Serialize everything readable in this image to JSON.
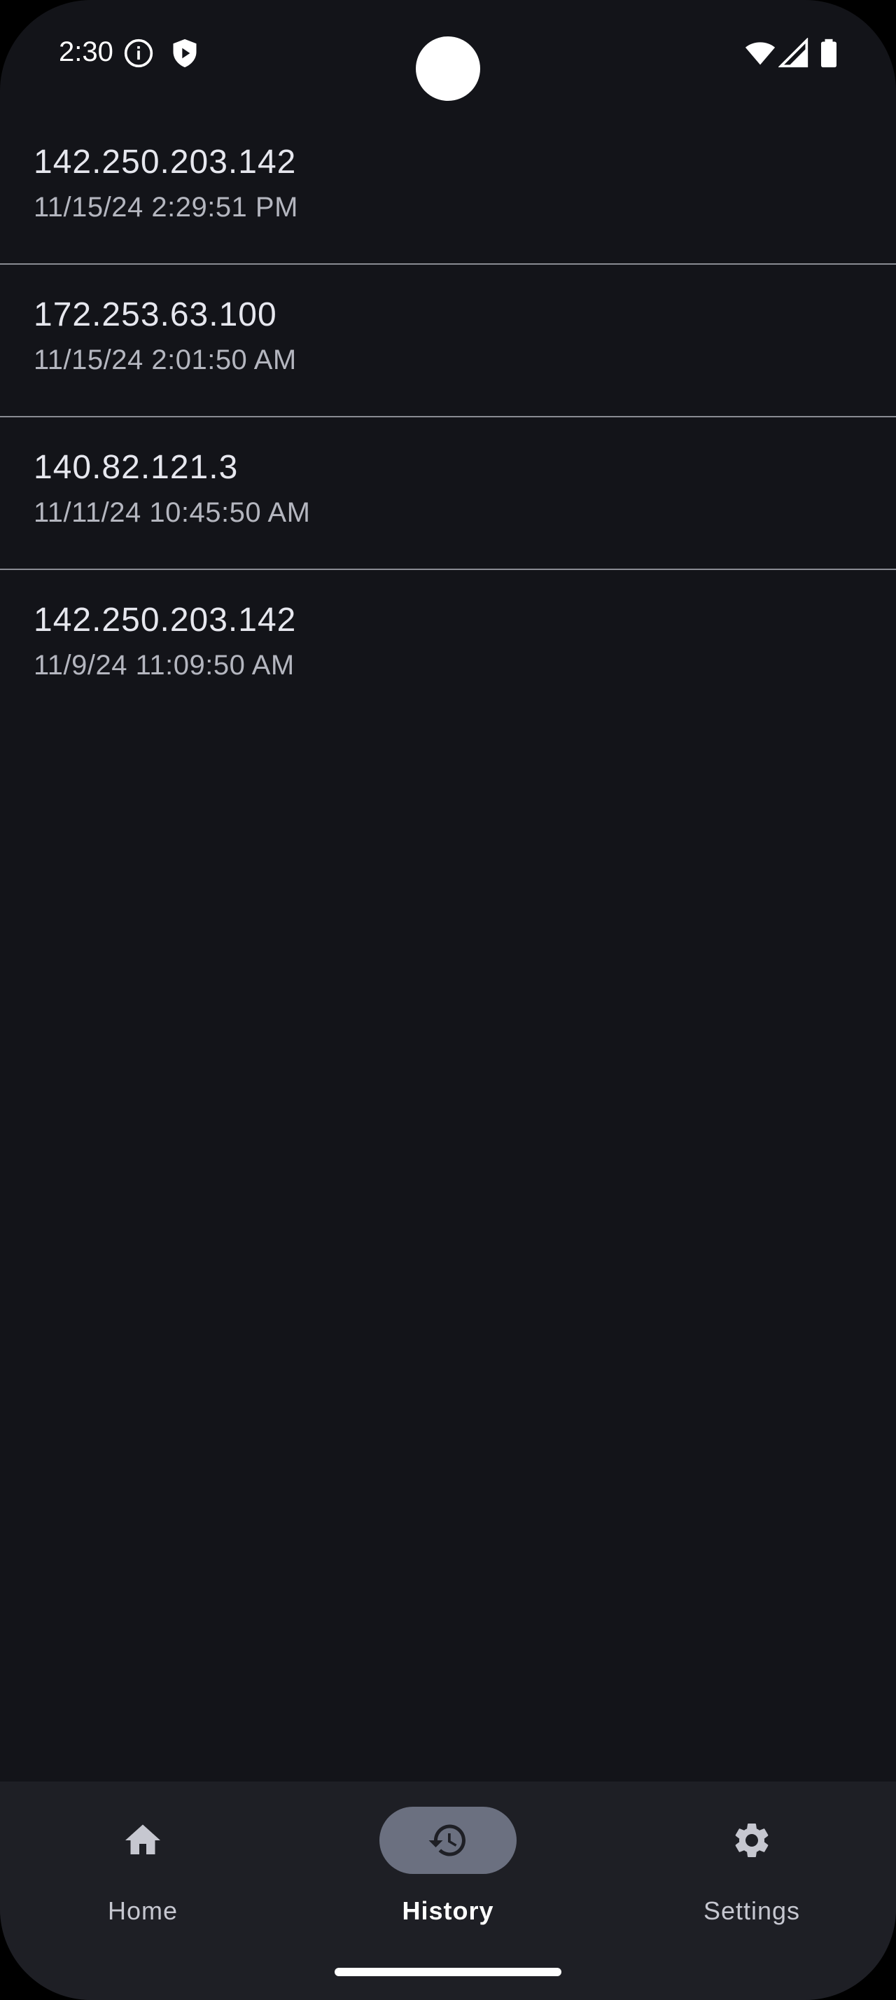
{
  "status_bar": {
    "time": "2:30",
    "icons": [
      "info-icon",
      "shield-play-icon",
      "wifi-icon",
      "cellular-signal-icon",
      "battery-icon"
    ]
  },
  "history": {
    "items": [
      {
        "ip": "142.250.203.142",
        "time": "11/15/24 2:29:51 PM"
      },
      {
        "ip": "172.253.63.100",
        "time": "11/15/24 2:01:50 AM"
      },
      {
        "ip": "140.82.121.3",
        "time": "11/11/24 10:45:50 AM"
      },
      {
        "ip": "142.250.203.142",
        "time": "11/9/24 11:09:50 AM"
      }
    ]
  },
  "nav": {
    "items": [
      {
        "label": "Home",
        "icon": "home-icon",
        "active": false
      },
      {
        "label": "History",
        "icon": "history-icon",
        "active": true
      },
      {
        "label": "Settings",
        "icon": "gear-icon",
        "active": false
      }
    ]
  },
  "colors": {
    "background": "#131419",
    "nav_background": "#1e1f25",
    "active_pill": "#6b7080",
    "divider": "#8a8c93"
  }
}
